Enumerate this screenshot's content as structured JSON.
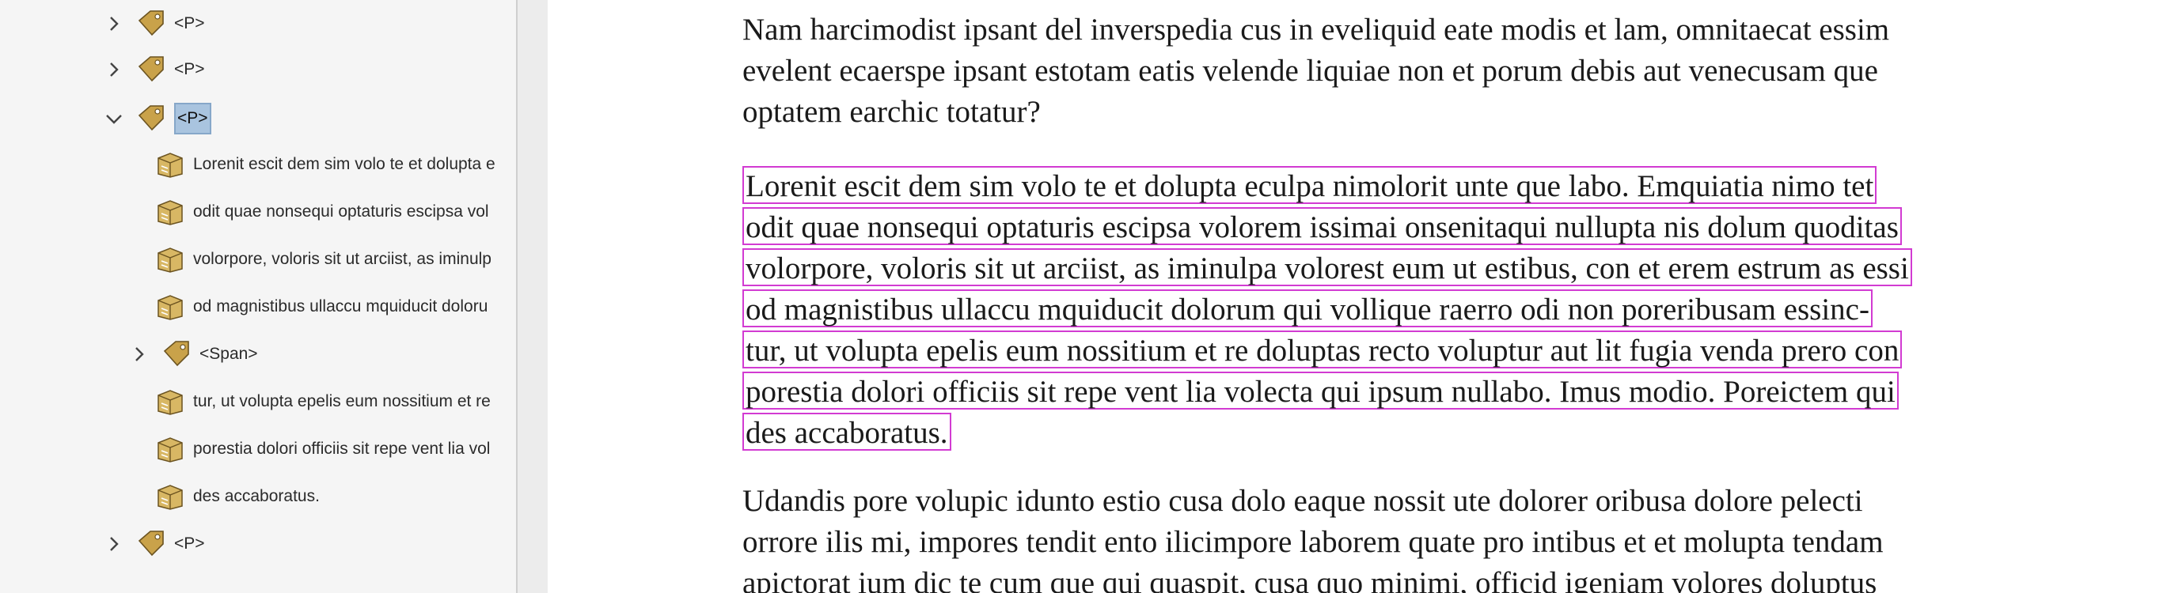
{
  "tree": {
    "nodes": [
      {
        "label": "<P>",
        "expanded": false
      },
      {
        "label": "<P>",
        "expanded": false
      },
      {
        "label": "<P>",
        "expanded": true,
        "selected": true
      },
      {
        "label": "Lorenit escit dem sim volo te et dolupta e",
        "kind": "content"
      },
      {
        "label": "odit quae nonsequi optaturis escipsa vol",
        "kind": "content"
      },
      {
        "label": "volorpore, voloris sit ut arciist, as iminulp",
        "kind": "content"
      },
      {
        "label": "od magnistibus ullaccu mquiducit doloru",
        "kind": "content"
      },
      {
        "label": "<Span>",
        "expanded": false
      },
      {
        "label": "tur, ut volupta epelis eum nossitium et re",
        "kind": "content"
      },
      {
        "label": "porestia dolori officiis sit repe vent lia vol",
        "kind": "content"
      },
      {
        "label": "des accaboratus.",
        "kind": "content"
      },
      {
        "label": "<P>",
        "expanded": false
      }
    ]
  },
  "document": {
    "para1": [
      "Nam harcimodist ipsant del inverspedia cus in eveliquid eate modis et lam, omnitaecat essim",
      "evelent ecaerspe ipsant estotam eatis velende liquiae non et porum debis aut venecusam que",
      "optatem earchic totatur?"
    ],
    "para2": [
      "Lorenit escit dem sim volo te et dolupta eculpa nimolorit unte que labo. Emquiatia nimo tet",
      "odit quae nonsequi optaturis escipsa volorem issimai onsenitaqui nullupta nis dolum quoditas",
      "volorpore, voloris sit ut arciist, as iminulpa volorest eum ut estibus, con et erem estrum as essi",
      "od magnistibus ullaccu mquiducit dolorum qui vollique raerro odi non poreribusam essinc-",
      "tur, ut volupta epelis eum nossitium et re doluptas recto voluptur aut lit fugia venda prero con",
      "porestia dolori officiis sit repe vent lia volecta qui ipsum nullabo. Imus modio. Poreictem qui",
      "des accaboratus."
    ],
    "para3": [
      "Udandis pore volupic idunto estio cusa dolo eaque nossit ute dolorer oribusa dolore pelecti",
      "orrore ilis mi, impores tendit ento ilicimpore laborem quate pro intibus et et molupta tendam",
      "apictorat ium dic te cum que qui quaspit, cusa quo minimi, officid igeniam volores doluptus"
    ]
  },
  "colors": {
    "highlight_border": "#d23bd2",
    "selection_fill": "#a9c4df"
  }
}
